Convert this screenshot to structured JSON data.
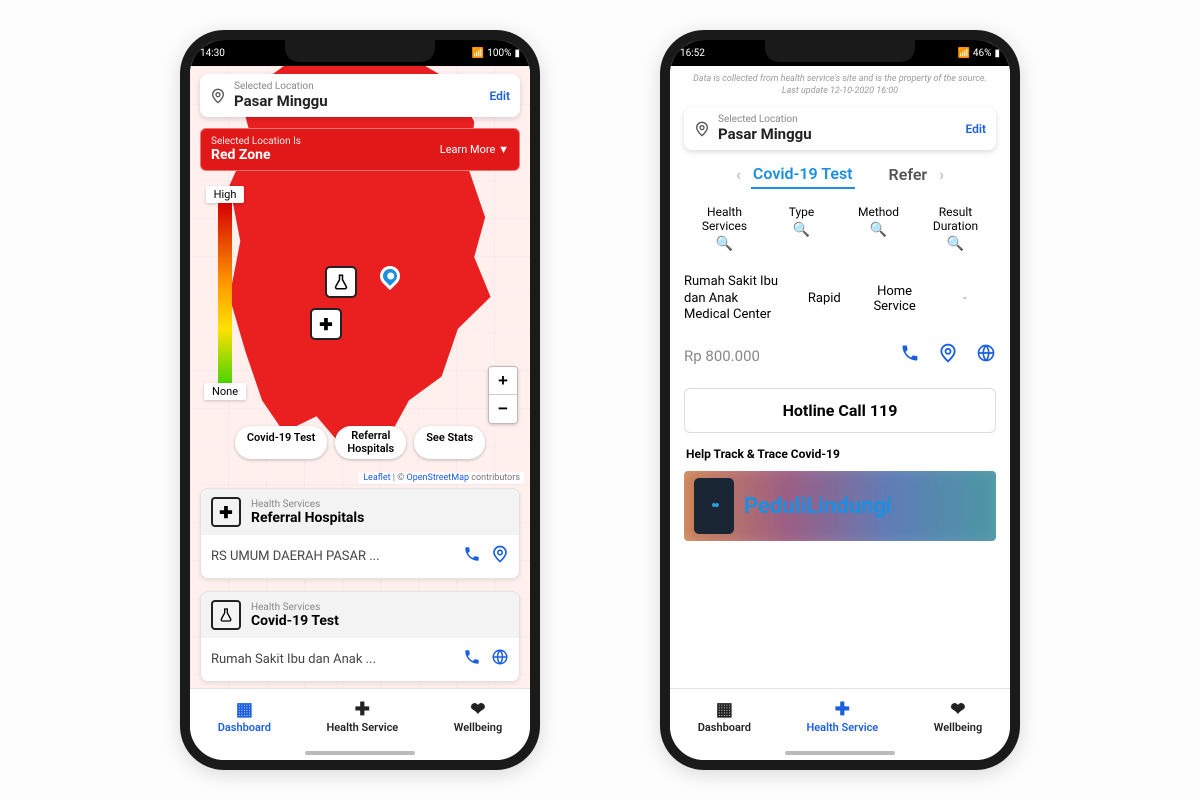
{
  "left": {
    "status": {
      "time": "14:30",
      "battery": "100%"
    },
    "location": {
      "label": "Selected Location",
      "value": "Pasar Minggu",
      "edit": "Edit"
    },
    "zone": {
      "label": "Selected Location Is",
      "value": "Red Zone",
      "learn": "Learn More"
    },
    "legend": {
      "high": "High",
      "none": "None"
    },
    "chips": {
      "test": "Covid-19 Test",
      "referral": "Referral\nHospitals",
      "stats": "See Stats"
    },
    "attrib": {
      "leaflet": "Leaflet",
      "sep": " | © ",
      "osm": "OpenStreetMap",
      "tail": " contributors"
    },
    "cards": {
      "referral": {
        "sub": "Health Services",
        "title": "Referral Hospitals",
        "row": "RS UMUM DAERAH PASAR ..."
      },
      "test": {
        "sub": "Health Services",
        "title": "Covid-19 Test",
        "row": "Rumah Sakit Ibu dan Anak ..."
      }
    },
    "nav": {
      "dash": "Dashboard",
      "health": "Health Service",
      "well": "Wellbeing"
    }
  },
  "right": {
    "status": {
      "time": "16:52",
      "battery": "46%"
    },
    "disclaimer": "Data is collected from health service's site and is the property of the source. Last update 12-10-2020 16:00",
    "location": {
      "label": "Selected Location",
      "value": "Pasar Minggu",
      "edit": "Edit"
    },
    "tabs": {
      "test": "Covid-19 Test",
      "refer": "Refer"
    },
    "filters": {
      "services": "Health Services",
      "type": "Type",
      "method": "Method",
      "duration": "Result Duration"
    },
    "row": {
      "name": "Rumah Sakit Ibu dan Anak Medical Center",
      "type": "Rapid",
      "method": "Home Service",
      "duration": "-"
    },
    "price": "Rp 800.000",
    "hotline": "Hotline Call 119",
    "track": "Help Track & Trace Covid-19",
    "banner": "PeduliLindungi",
    "nav": {
      "dash": "Dashboard",
      "health": "Health Service",
      "well": "Wellbeing"
    }
  }
}
